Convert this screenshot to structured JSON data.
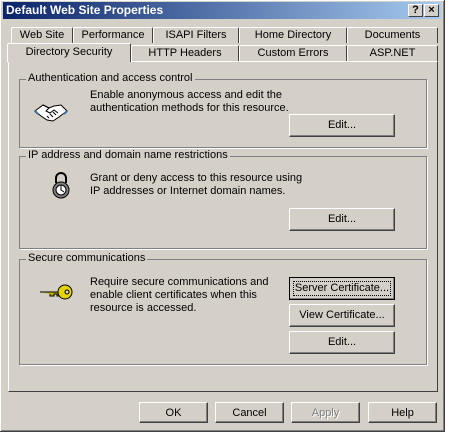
{
  "window": {
    "title": "Default Web Site Properties",
    "help_glyph": "?",
    "close_glyph": "×"
  },
  "tabs_back": [
    "Web Site",
    "Performance",
    "ISAPI Filters",
    "Home Directory",
    "Documents"
  ],
  "tabs_front": [
    "Directory Security",
    "HTTP Headers",
    "Custom Errors",
    "ASP.NET"
  ],
  "active_tab": "Directory Security",
  "auth": {
    "legend": "Authentication and access control",
    "text_line1": "Enable anonymous access and edit the",
    "text_line2": "authentication methods for this resource.",
    "edit_label": "Edit...",
    "icon": "handshake-icon"
  },
  "ip": {
    "legend": "IP address and domain name restrictions",
    "text_line1": "Grant or deny access to this resource using",
    "text_line2": "IP addresses or Internet domain names.",
    "edit_label": "Edit...",
    "icon": "lock-icon"
  },
  "secure": {
    "legend": "Secure communications",
    "text_line1": "Require secure communications and",
    "text_line2": "enable client certificates when this",
    "text_line3": "resource is accessed.",
    "server_cert_label": "Server Certificate...",
    "view_cert_label": "View Certificate...",
    "edit_label": "Edit...",
    "icon": "key-icon"
  },
  "footer": {
    "ok_label": "OK",
    "cancel_label": "Cancel",
    "apply_label": "Apply",
    "help_label": "Help"
  },
  "colors": {
    "title_start": "#0a246a",
    "title_end": "#a6caf0",
    "face": "#d4d0c8"
  }
}
